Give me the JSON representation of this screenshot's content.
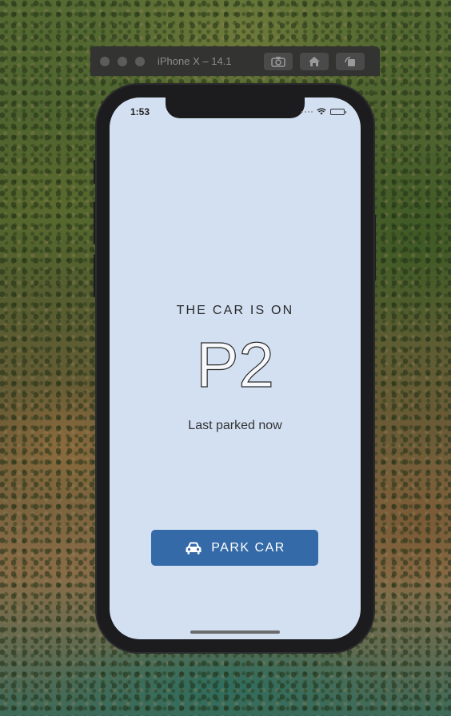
{
  "simulator": {
    "title": "iPhone X – 14.1",
    "buttons": [
      "screenshot-icon",
      "home-icon",
      "rotate-icon"
    ]
  },
  "status_bar": {
    "time": "1:53",
    "icons": [
      "signal-dots-icon",
      "wifi-icon",
      "battery-icon"
    ]
  },
  "app": {
    "heading": "THE CAR IS ON",
    "level": "P2",
    "last_parked": "Last parked now",
    "park_button": {
      "label": "PARK CAR",
      "icon": "car-icon",
      "color": "#346aa8"
    },
    "background_color": "#d2e0f2"
  }
}
